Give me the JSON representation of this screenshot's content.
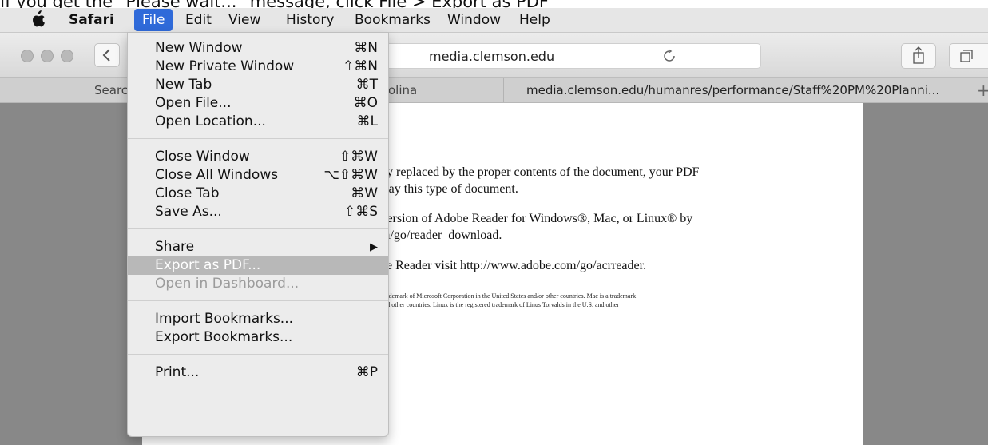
{
  "caption": "If you get the \"Please wait...\" message, click File > Export as PDF",
  "menubar": {
    "items": [
      {
        "label": "Safari"
      },
      {
        "label": "File"
      },
      {
        "label": "Edit"
      },
      {
        "label": "View"
      },
      {
        "label": "History"
      },
      {
        "label": "Bookmarks"
      },
      {
        "label": "Window"
      },
      {
        "label": "Help"
      }
    ]
  },
  "toolbar": {
    "address": "media.clemson.edu",
    "back_icon": "chevron-left-icon",
    "reload_icon": "reload-icon",
    "share_icon": "share-icon",
    "tabs_icon": "tab-overview-icon"
  },
  "tabs": [
    {
      "label": "Searc"
    },
    {
      "label": "olina"
    },
    {
      "label": "media.clemson.edu/humanres/performance/Staff%20PM%20Planni..."
    },
    {
      "label": "+"
    }
  ],
  "document": {
    "lines": [
      "ally replaced by the proper contents of the document, your PDF",
      "splay this type of document.",
      "t version of Adobe Reader for Windows®, Mac, or Linux® by",
      "om/go/reader_download.",
      "obe Reader visit  http://www.adobe.com/go/acrreader."
    ],
    "fine": [
      "r a trademark of Microsoft Corporation in the United States and/or other countries. Mac is a trademark",
      "es and other countries. Linux is the registered trademark of Linus Torvalds in the U.S. and other"
    ]
  },
  "file_menu": {
    "items": [
      {
        "label": "New Window",
        "shortcut": "⌘N"
      },
      {
        "label": "New Private Window",
        "shortcut": "⇧⌘N"
      },
      {
        "label": "New Tab",
        "shortcut": "⌘T"
      },
      {
        "label": "Open File...",
        "shortcut": "⌘O"
      },
      {
        "label": "Open Location...",
        "shortcut": "⌘L"
      },
      {
        "label": "Close Window",
        "shortcut": "⇧⌘W"
      },
      {
        "label": "Close All Windows",
        "shortcut": "⌥⇧⌘W"
      },
      {
        "label": "Close Tab",
        "shortcut": "⌘W"
      },
      {
        "label": "Save As...",
        "shortcut": "⇧⌘S"
      },
      {
        "label": "Share",
        "shortcut": "▶"
      },
      {
        "label": "Export as PDF...",
        "shortcut": ""
      },
      {
        "label": "Open in Dashboard...",
        "shortcut": ""
      },
      {
        "label": "Import Bookmarks...",
        "shortcut": ""
      },
      {
        "label": "Export Bookmarks...",
        "shortcut": ""
      },
      {
        "label": "Print...",
        "shortcut": "⌘P"
      }
    ]
  },
  "colors": {
    "menu_active": "#2f6ad9",
    "menu_highlight": "#b8b8b8",
    "content_bg": "#888888"
  }
}
